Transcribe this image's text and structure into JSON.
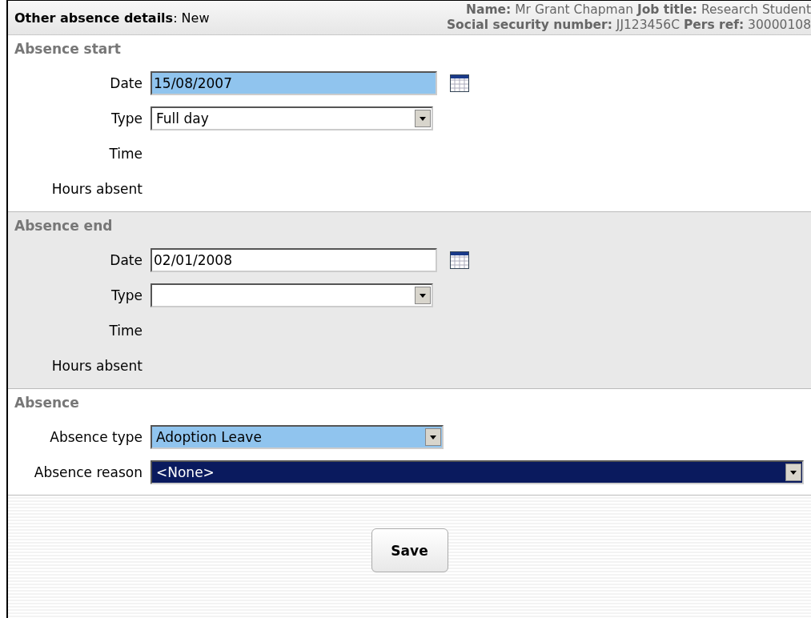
{
  "header": {
    "title": "**Other absence details**: New",
    "info": [
      "**Name:** Mr Grant Chapman **Job title:** Research Student",
      "**Social security number:** JJ123456C **Pers ref:** 30000108"
    ]
  },
  "sections": [
    {
      "title": "Absence start",
      "shaded": false,
      "fields": [
        {
          "kind": "date",
          "label": "Date",
          "value": "15/08/2007",
          "highlighted": true
        },
        {
          "kind": "select",
          "label": "Type",
          "value": "Full day",
          "highlighted": false,
          "selected": false
        },
        {
          "kind": "static",
          "label": "Time"
        },
        {
          "kind": "static",
          "label": "Hours absent"
        }
      ]
    },
    {
      "title": "Absence end",
      "shaded": true,
      "fields": [
        {
          "kind": "date",
          "label": "Date",
          "value": "02/01/2008",
          "highlighted": false
        },
        {
          "kind": "select",
          "label": "Type",
          "highlighted": false,
          "selected": false
        },
        {
          "kind": "static",
          "label": "Time"
        },
        {
          "kind": "static",
          "label": "Hours absent"
        }
      ]
    },
    {
      "title": "Absence",
      "shaded": false,
      "fields": [
        {
          "kind": "select",
          "label": "Absence type",
          "value": "Adoption Leave",
          "highlighted": true,
          "selected": false
        },
        {
          "kind": "select",
          "label": "Absence reason",
          "value": "<None>",
          "highlighted": false,
          "selected": true,
          "wide": true
        }
      ]
    }
  ],
  "save_button": "Save"
}
